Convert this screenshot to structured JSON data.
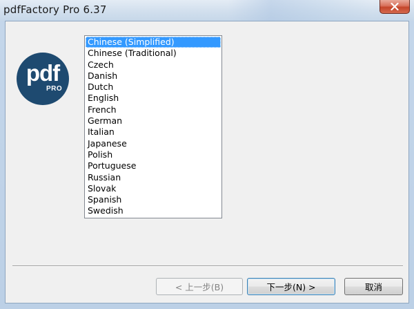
{
  "window": {
    "title": "pdfFactory Pro 6.37"
  },
  "logo": {
    "main": "pdf",
    "sub": "PRO",
    "color": "#1e4a70"
  },
  "language_list": {
    "selected_index": 0,
    "items": [
      "Chinese (Simplified)",
      "Chinese (Traditional)",
      "Czech",
      "Danish",
      "Dutch",
      "English",
      "French",
      "German",
      "Italian",
      "Japanese",
      "Polish",
      "Portuguese",
      "Russian",
      "Slovak",
      "Spanish",
      "Swedish"
    ]
  },
  "buttons": {
    "back": {
      "label": "< 上一步(B)",
      "enabled": false
    },
    "next": {
      "label": "下一步(N) >",
      "enabled": true
    },
    "cancel": {
      "label": "取消",
      "enabled": true
    }
  },
  "colors": {
    "selection": "#3399ff",
    "close_button": "#c4452a"
  },
  "icons": {
    "close": "close-icon"
  }
}
